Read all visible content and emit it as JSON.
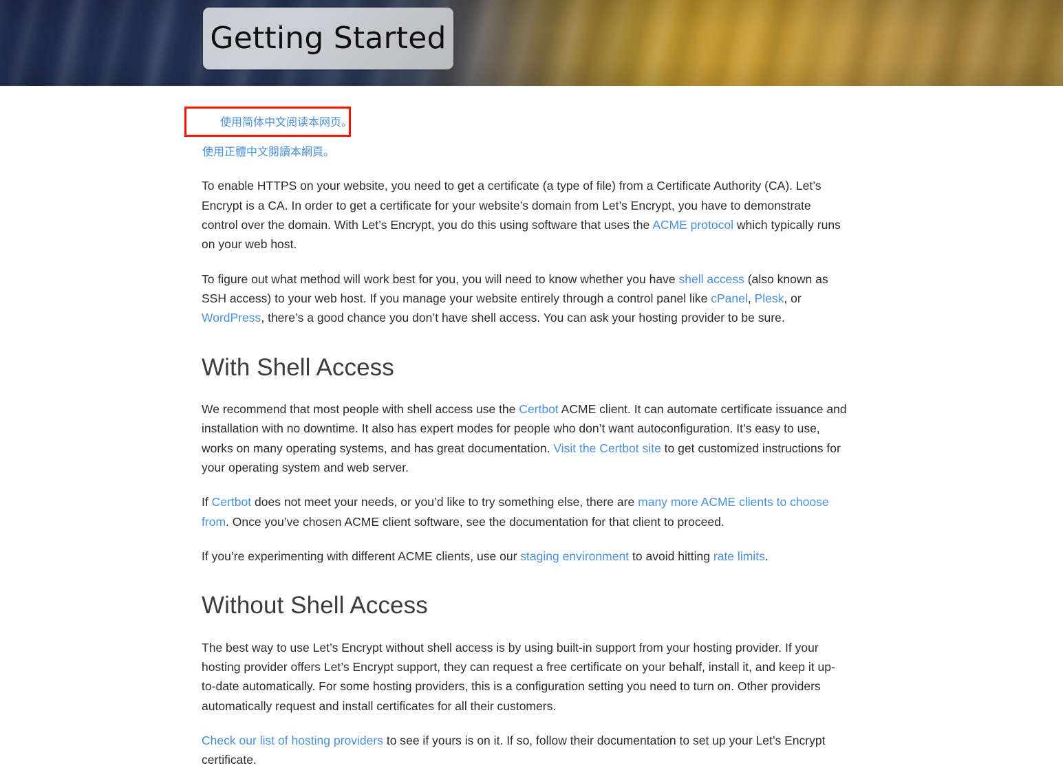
{
  "banner": {
    "title": "Getting Started",
    "colors": {
      "left": "#1f2c4e",
      "right": "#c79b2f",
      "title_plate": "#c9ccd4",
      "title_text": "#101010"
    }
  },
  "theme": {
    "link_color": "#4a90d9",
    "body_text_color": "#2b2b2b",
    "heading_color": "#3c3c3c",
    "highlight_box_color": "#fa1405",
    "page_background": "#ffffff"
  },
  "language_links": {
    "simplified_chinese": "使用简体中文阅读本网页。",
    "traditional_chinese": "使用正體中文閱讀本網頁。"
  },
  "intro": {
    "paragraph_1": [
      {
        "t": "To enable HTTPS on your website, you need to get a certificate (a type of file) from a Certificate Authority (CA). Let’s Encrypt is a CA. In order to get a certificate for your website’s domain from Let’s Encrypt, you have to demonstrate control over the domain. With Let’s Encrypt, you do this using software that uses the ",
        "link": false
      },
      {
        "t": "ACME protocol",
        "link": true
      },
      {
        "t": " which typically runs on your web host.",
        "link": false
      }
    ],
    "paragraph_2": [
      {
        "t": "To figure out what method will work best for you, you will need to know whether you have ",
        "link": false
      },
      {
        "t": "shell access",
        "link": true
      },
      {
        "t": " (also known as SSH access) to your web host. If you manage your website entirely through a control panel like ",
        "link": false
      },
      {
        "t": "cPanel",
        "link": true
      },
      {
        "t": ", ",
        "link": false
      },
      {
        "t": "Plesk",
        "link": true
      },
      {
        "t": ", or ",
        "link": false
      },
      {
        "t": "WordPress",
        "link": true
      },
      {
        "t": ", there’s a good chance you don’t have shell access. You can ask your hosting provider to be sure.",
        "link": false
      }
    ]
  },
  "with_shell_access": {
    "heading": "With Shell Access",
    "paragraph_1": [
      {
        "t": "We recommend that most people with shell access use the ",
        "link": false
      },
      {
        "t": "Certbot",
        "link": true
      },
      {
        "t": " ACME client. It can automate certificate issuance and installation with no downtime. It also has expert modes for people who don’t want autoconfiguration. It’s easy to use, works on many operating systems, and has great documentation. ",
        "link": false
      },
      {
        "t": "Visit the Certbot site",
        "link": true
      },
      {
        "t": " to get customized instructions for your operating system and web server.",
        "link": false
      }
    ],
    "paragraph_2": [
      {
        "t": "If ",
        "link": false
      },
      {
        "t": "Certbot",
        "link": true
      },
      {
        "t": " does not meet your needs, or you’d like to try something else, there are ",
        "link": false
      },
      {
        "t": "many more ACME clients to choose from",
        "link": true
      },
      {
        "t": ". Once you’ve chosen ACME client software, see the documentation for that client to proceed.",
        "link": false
      }
    ],
    "paragraph_3": [
      {
        "t": "If you’re experimenting with different ACME clients, use our ",
        "link": false
      },
      {
        "t": "staging environment",
        "link": true
      },
      {
        "t": " to avoid hitting ",
        "link": false
      },
      {
        "t": "rate limits",
        "link": true
      },
      {
        "t": ".",
        "link": false
      }
    ]
  },
  "without_shell_access": {
    "heading": "Without Shell Access",
    "paragraph_1": [
      {
        "t": "The best way to use Let’s Encrypt without shell access is by using built-in support from your hosting provider. If your hosting provider offers Let’s Encrypt support, they can request a free certificate on your behalf, install it, and keep it up-to-date automatically. For some hosting providers, this is a configuration setting you need to turn on. Other providers automatically request and install certificates for all their customers.",
        "link": false
      }
    ],
    "paragraph_2": [
      {
        "t": "Check our list of hosting providers",
        "link": true
      },
      {
        "t": " to see if yours is on it. If so, follow their documentation to set up your Let’s Encrypt certificate.",
        "link": false
      }
    ]
  }
}
